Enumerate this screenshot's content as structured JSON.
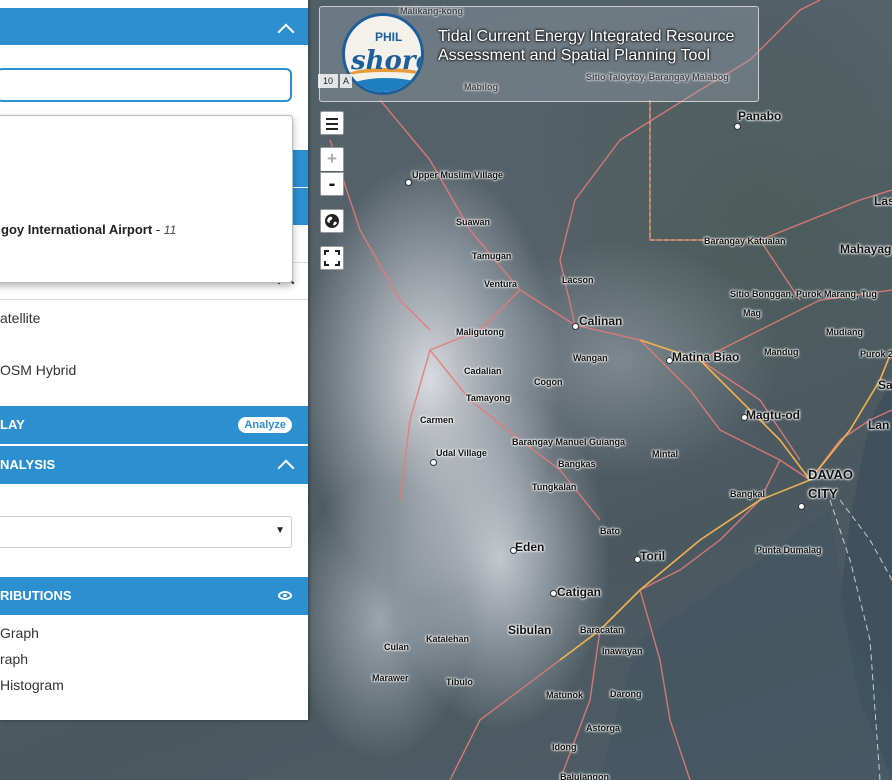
{
  "app": {
    "title": "Tidal Current Energy Integrated Resource Assessment and Spatial Planning Tool",
    "logo_text_top": "PHIL",
    "logo_text_main": "shore"
  },
  "search": {
    "value": "",
    "result": {
      "name": "goy International Airport",
      "separator": "-",
      "distance": "11"
    }
  },
  "basemap": {
    "options": [
      "atellite",
      "OSM Hybrid"
    ]
  },
  "overlay": {
    "label": "LAY",
    "badge": "Analyze"
  },
  "analysis": {
    "label": "NALYSIS",
    "select_value": ""
  },
  "distributions": {
    "label": "RIBUTIONS",
    "items": [
      "Graph",
      "raph",
      "Histogram"
    ]
  },
  "controls": {
    "zoom_in": "+",
    "zoom_out": "-"
  },
  "scale": {
    "text_a": "10",
    "text_b": "A"
  },
  "map_labels": [
    "Malikang-kong",
    "Sitio Taloytoy, Barangay Malabog",
    "Mabilog",
    "Panabo",
    "Upper Muslim Village",
    "Suawan",
    "Tamugan",
    "Ventura",
    "Lacson",
    "Barangay Katualan",
    "Las",
    "Mahayag",
    "Sitio Bonggan, Purok Marang, Tug",
    "Mag",
    "Mudiang",
    "Purok 2",
    "Maligutong",
    "Calinan",
    "Matina Biao",
    "Mandug",
    "Wangan",
    "Sa",
    "Cadalian",
    "Cogon",
    "Tamayong",
    "Magtu-od",
    "Carmen",
    "Lan",
    "Barangay Manuel Guianga",
    "Udal Village",
    "Mintal",
    "Bangkas",
    "DAVAO",
    "CITY",
    "Tungkalan",
    "Bangkal",
    "Bato",
    "Eden",
    "Toril",
    "Punta Dumalag",
    "Catigan",
    "Sibulan",
    "Baracatan",
    "Katalehan",
    "Culan",
    "Inawayan",
    "Marawer",
    "Tibulo",
    "Matunok",
    "Darong",
    "Astorga",
    "Idong",
    "Balulangon"
  ]
}
